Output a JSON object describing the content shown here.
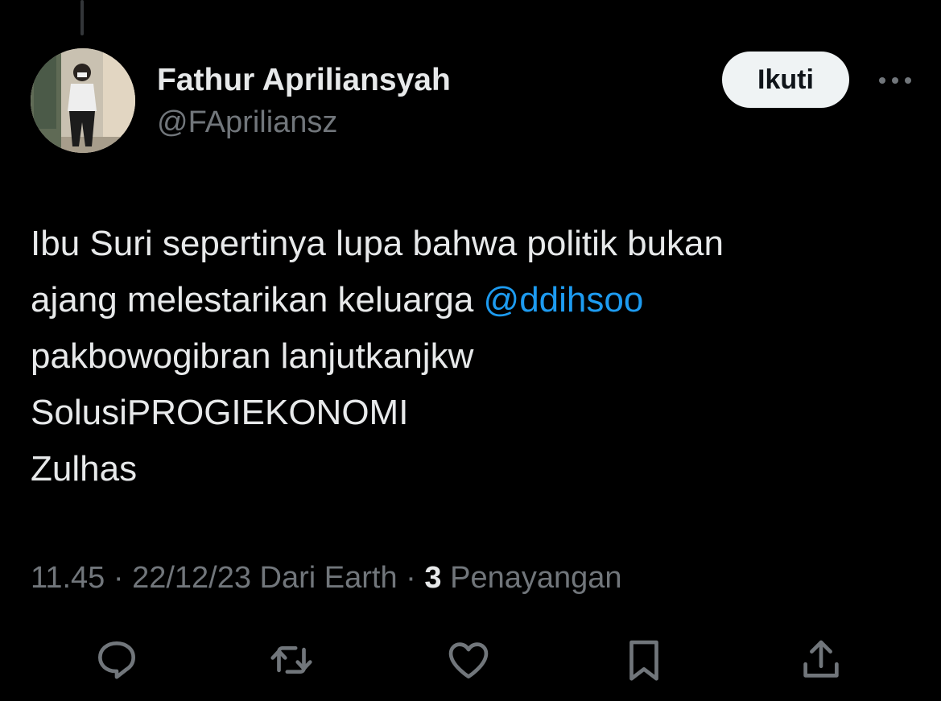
{
  "author": {
    "name": "Fathur Apriliansyah",
    "handle": "@FApriliansz"
  },
  "follow_label": "Ikuti",
  "tweet": {
    "line1": "Ibu Suri sepertinya lupa bahwa politik bukan",
    "line2_prefix": "ajang melestarikan keluarga ",
    "mention": "@ddihsoo",
    "line3": "pakbowogibran lanjutkanjkw",
    "line4": "SolusiPROGIEKONOMI",
    "line5": "Zulhas"
  },
  "meta": {
    "time": "11.45",
    "separator": " · ",
    "date": "22/12/23",
    "source": "Dari Earth",
    "views_count": "3",
    "views_label": "Penayangan"
  },
  "icons": {
    "reply": "reply-icon",
    "retweet": "retweet-icon",
    "like": "heart-icon",
    "bookmark": "bookmark-icon",
    "share": "share-icon",
    "more": "more-horizontal-icon"
  },
  "colors": {
    "background": "#000000",
    "text": "#e7e9ea",
    "secondary": "#71767b",
    "mention": "#1d9bf0",
    "follow_bg": "#eff3f4"
  }
}
